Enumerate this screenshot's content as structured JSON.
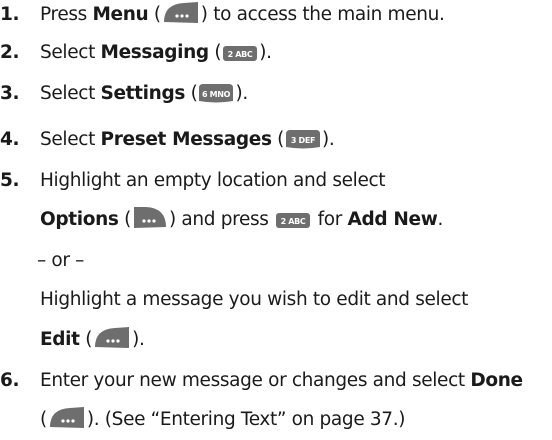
{
  "steps": [
    {
      "number": "1.",
      "pre": "Press ",
      "bold": "Menu",
      "open": " (",
      "close": ") to access the main menu.",
      "icon": "menu-softkey-icon"
    },
    {
      "number": "2.",
      "pre": "Select ",
      "bold": "Messaging",
      "open": " (",
      "close": ").",
      "icon": "key-2abc-icon",
      "key_text": "2 ABC"
    },
    {
      "number": "3.",
      "pre": "Select ",
      "bold": "Settings",
      "open": " (",
      "close": ").",
      "icon": "key-6mno-icon",
      "key_text": "6 MNO"
    },
    {
      "number": "4.",
      "pre": "Select ",
      "bold": "Preset Messages",
      "open": " (",
      "close": ").",
      "icon": "key-3def-icon",
      "key_text": "3 DEF"
    },
    {
      "number": "5.",
      "line1": "Highlight an empty location and select",
      "line2": {
        "bold": "Options",
        "open": " (",
        "mid": ") and press ",
        "key_text": "2 ABC",
        "after": " for ",
        "bold2": "Add New",
        "end": "."
      },
      "or": "– or –",
      "line4": "Highlight a message you wish to edit and select",
      "line5": {
        "bold": "Edit",
        "open": " (",
        "close": ")."
      }
    },
    {
      "number": "6.",
      "line1": {
        "pre": "Enter your new message or changes and select ",
        "bold": "Done"
      },
      "line2": {
        "open": "(",
        "close": "). (See “Entering Text” on page 37.)"
      }
    }
  ],
  "colors": {
    "text": "#1a1a1a",
    "key_face": "#6e6e6e",
    "key_text": "#ffffff"
  }
}
